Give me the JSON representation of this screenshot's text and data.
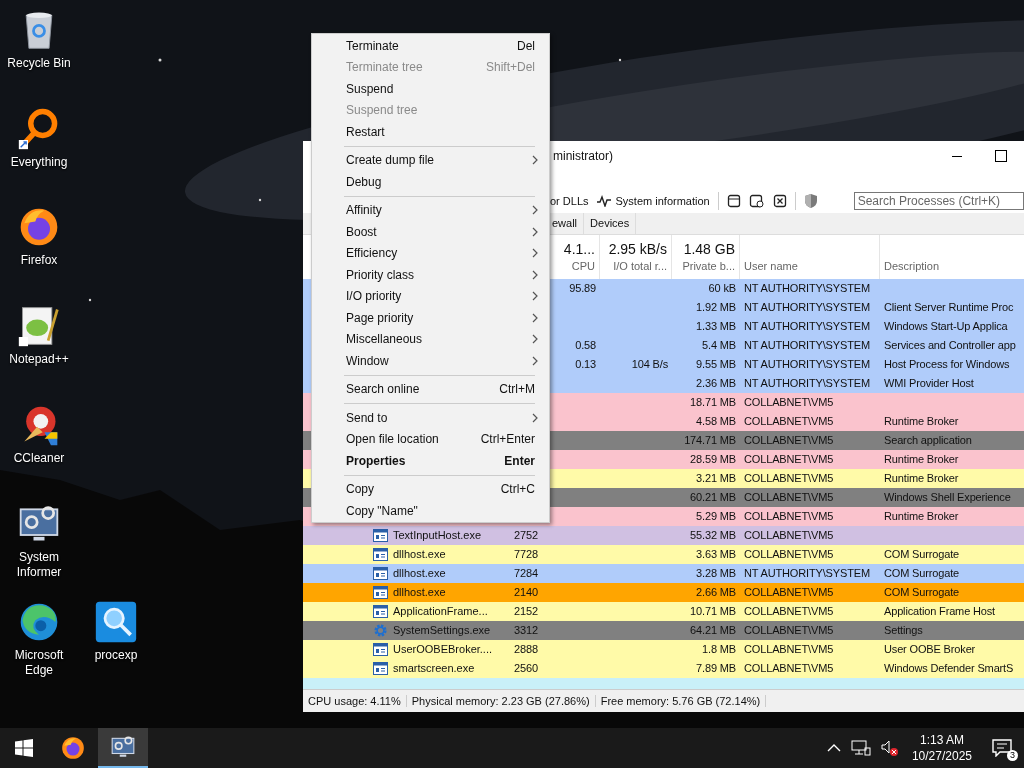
{
  "desktop_icons": [
    {
      "label": "Recycle Bin",
      "kind": "recycle-bin"
    },
    {
      "label": "Everything",
      "kind": "everything"
    },
    {
      "label": "Firefox",
      "kind": "firefox"
    },
    {
      "label": "Notepad++",
      "kind": "notepad"
    },
    {
      "label": "CCleaner",
      "kind": "ccleaner"
    },
    {
      "label": "System Informer",
      "kind": "system-informer"
    },
    {
      "label": "Microsoft Edge",
      "kind": "edge"
    },
    {
      "label": "procexp",
      "kind": "procexp"
    }
  ],
  "window": {
    "title": "ministrator)",
    "toolbar": {
      "dll_button": "or DLLs",
      "sysinfo_button": "System information",
      "search": {
        "placeholder": "Search Processes (Ctrl+K)"
      }
    },
    "tabs": [
      {
        "label": "ewall",
        "selected": false
      },
      {
        "label": "Devices",
        "selected": false
      }
    ],
    "columns": [
      {
        "summary": "4.1...",
        "label": "CPU"
      },
      {
        "summary": "2.95 kB/s",
        "label": "I/O total r..."
      },
      {
        "summary": "1.48 GB",
        "label": "Private b..."
      },
      {
        "label": "User name"
      },
      {
        "label": "Description"
      }
    ],
    "rows": [
      {
        "cpu": "95.89",
        "private": "60 kB",
        "user": "NT AUTHORITY\\SYSTEM",
        "color": "#b0ccfa"
      },
      {
        "private": "1.92 MB",
        "user": "NT AUTHORITY\\SYSTEM",
        "description": "Client Server Runtime Proc",
        "color": "#b0ccfa"
      },
      {
        "private": "1.33 MB",
        "user": "NT AUTHORITY\\SYSTEM",
        "description": "Windows Start-Up Applica",
        "color": "#b0ccfa"
      },
      {
        "cpu": "0.58",
        "private": "5.4 MB",
        "user": "NT AUTHORITY\\SYSTEM",
        "description": "Services and Controller app",
        "color": "#b0ccfa"
      },
      {
        "cpu": "0.13",
        "io": "104 B/s",
        "private": "9.55 MB",
        "user": "NT AUTHORITY\\SYSTEM",
        "description": "Host Process for Windows",
        "color": "#b0ccfa"
      },
      {
        "private": "2.36 MB",
        "user": "NT AUTHORITY\\SYSTEM",
        "description": "WMI Provider Host",
        "color": "#b0ccfa"
      },
      {
        "private": "18.71 MB",
        "user": "COLLABNET\\VM5",
        "color": "#fac3cd"
      },
      {
        "private": "4.58 MB",
        "user": "COLLABNET\\VM5",
        "description": "Runtime Broker",
        "color": "#fac3cd"
      },
      {
        "private": "174.71 MB",
        "user": "COLLABNET\\VM5",
        "description": "Search application",
        "color": "#808080"
      },
      {
        "private": "28.59 MB",
        "user": "COLLABNET\\VM5",
        "description": "Runtime Broker",
        "color": "#fac3cd"
      },
      {
        "private": "3.21 MB",
        "user": "COLLABNET\\VM5",
        "description": "Runtime Broker",
        "color": "#fffaa8"
      },
      {
        "private": "60.21 MB",
        "user": "COLLABNET\\VM5",
        "description": "Windows Shell Experience",
        "color": "#808080"
      },
      {
        "private": "5.29 MB",
        "user": "COLLABNET\\VM5",
        "description": "Runtime Broker",
        "color": "#fac3cd"
      },
      {
        "name": "TextInputHost.exe",
        "pid": "2752",
        "kind": "app",
        "private": "55.32 MB",
        "user": "COLLABNET\\VM5",
        "color": "#d0c0e2"
      },
      {
        "name": "dllhost.exe",
        "pid": "7728",
        "kind": "app",
        "private": "3.63 MB",
        "user": "COLLABNET\\VM5",
        "description": "COM Surrogate",
        "color": "#fffaa8"
      },
      {
        "name": "dllhost.exe",
        "pid": "7284",
        "kind": "app",
        "private": "3.28 MB",
        "user": "NT AUTHORITY\\SYSTEM",
        "description": "COM Surrogate",
        "color": "#b0ccfa"
      },
      {
        "name": "dllhost.exe",
        "pid": "2140",
        "kind": "app",
        "private": "2.66 MB",
        "user": "COLLABNET\\VM5",
        "description": "COM Surrogate",
        "color": "#ffa500"
      },
      {
        "name": "ApplicationFrame...",
        "pid": "2152",
        "kind": "app",
        "private": "10.71 MB",
        "user": "COLLABNET\\VM5",
        "description": "Application Frame Host",
        "color": "#fffaa8"
      },
      {
        "name": "SystemSettings.exe",
        "pid": "3312",
        "kind": "gear",
        "private": "64.21 MB",
        "user": "COLLABNET\\VM5",
        "description": "Settings",
        "color": "#808080"
      },
      {
        "name": "UserOOBEBroker....",
        "pid": "2888",
        "kind": "app",
        "private": "1.8 MB",
        "user": "COLLABNET\\VM5",
        "description": "User OOBE Broker",
        "color": "#fffaa8"
      },
      {
        "name": "smartscreen.exe",
        "pid": "2560",
        "kind": "app",
        "private": "7.89 MB",
        "user": "COLLABNET\\VM5",
        "description": "Windows Defender SmartS",
        "color": "#fffaa8"
      }
    ],
    "status_bar": [
      "CPU usage: 4.11%",
      "Physical memory: 2.23 GB (27.86%)",
      "Free memory: 5.76 GB (72.14%)"
    ]
  },
  "context_menu": [
    {
      "kind": "item",
      "label": "Terminate",
      "shortcut": "Del",
      "disabled": false
    },
    {
      "kind": "item",
      "label": "Terminate tree",
      "shortcut": "Shift+Del",
      "disabled": true
    },
    {
      "kind": "item",
      "label": "Suspend",
      "disabled": false
    },
    {
      "kind": "item",
      "label": "Suspend tree",
      "disabled": true
    },
    {
      "kind": "item",
      "label": "Restart",
      "disabled": false
    },
    {
      "kind": "separator"
    },
    {
      "kind": "item",
      "label": "Create dump file",
      "submenu": true,
      "disabled": false
    },
    {
      "kind": "item",
      "label": "Debug",
      "disabled": false
    },
    {
      "kind": "separator"
    },
    {
      "kind": "item",
      "label": "Affinity",
      "submenu": true,
      "disabled": false
    },
    {
      "kind": "item",
      "label": "Boost",
      "submenu": true,
      "disabled": false
    },
    {
      "kind": "item",
      "label": "Efficiency",
      "submenu": true,
      "disabled": false
    },
    {
      "kind": "item",
      "label": "Priority class",
      "submenu": true,
      "disabled": false
    },
    {
      "kind": "item",
      "label": "I/O priority",
      "submenu": true,
      "disabled": false
    },
    {
      "kind": "item",
      "label": "Page priority",
      "submenu": true,
      "disabled": false
    },
    {
      "kind": "item",
      "label": "Miscellaneous",
      "submenu": true,
      "disabled": false
    },
    {
      "kind": "item",
      "label": "Window",
      "submenu": true,
      "disabled": false
    },
    {
      "kind": "separator"
    },
    {
      "kind": "item",
      "label": "Search online",
      "shortcut": "Ctrl+M",
      "disabled": false
    },
    {
      "kind": "separator"
    },
    {
      "kind": "item",
      "label": "Send to",
      "submenu": true,
      "disabled": false
    },
    {
      "kind": "item",
      "label": "Open file location",
      "shortcut": "Ctrl+Enter",
      "disabled": false
    },
    {
      "kind": "item",
      "label": "Properties",
      "shortcut": "Enter",
      "bold": true,
      "disabled": false
    },
    {
      "kind": "separator"
    },
    {
      "kind": "item",
      "label": "Copy",
      "shortcut": "Ctrl+C",
      "disabled": false
    },
    {
      "kind": "item",
      "label": "Copy \"Name\"",
      "disabled": false
    }
  ],
  "taskbar": {
    "apps": [
      {
        "kind": "firefox",
        "selected": false
      },
      {
        "kind": "system-informer",
        "selected": true
      }
    ],
    "time": "1:13 AM",
    "date": "10/27/2025",
    "notification_count": "3"
  }
}
